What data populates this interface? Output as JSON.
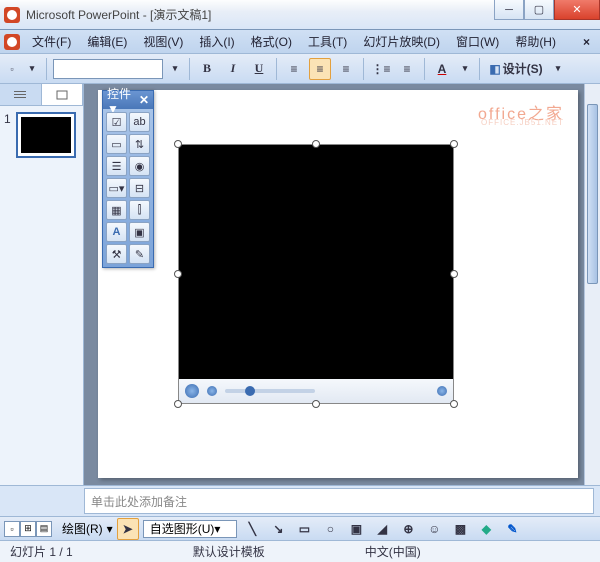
{
  "window": {
    "app": "Microsoft PowerPoint",
    "doc": "[演示文稿1]",
    "min": "─",
    "max": "▢",
    "close": "✕"
  },
  "menu": {
    "file": "文件(F)",
    "edit": "编辑(E)",
    "view": "视图(V)",
    "insert": "插入(I)",
    "format": "格式(O)",
    "tools": "工具(T)",
    "slideshow": "幻灯片放映(D)",
    "window": "窗口(W)",
    "help": "帮助(H)",
    "close_doc": "×"
  },
  "toolbar": {
    "bold": "B",
    "italic": "I",
    "underline": "U",
    "design": "设计(S)",
    "font_color": "A"
  },
  "toolbox": {
    "title": "控件",
    "arrow": "▼",
    "close": "✕"
  },
  "watermark": {
    "main": "office之家",
    "sub": "OFFICE.JB51.NET"
  },
  "notes": {
    "placeholder": "单击此处添加备注"
  },
  "drawbar": {
    "draw": "绘图(R)",
    "autoshapes": "自选图形(U)"
  },
  "status": {
    "slide": "幻灯片 1 / 1",
    "template": "默认设计模板",
    "lang": "中文(中国)"
  },
  "thumbs": {
    "n1": "1"
  }
}
